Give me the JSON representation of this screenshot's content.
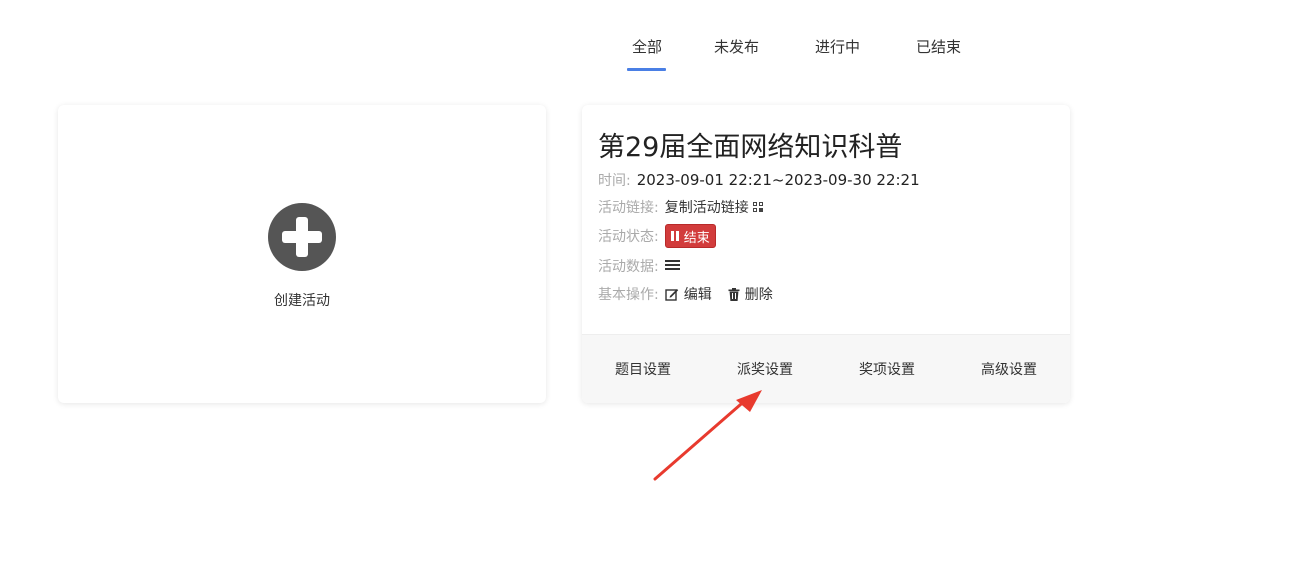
{
  "tabs": [
    {
      "label": "全部",
      "active": true
    },
    {
      "label": "未发布",
      "active": false
    },
    {
      "label": "进行中",
      "active": false
    },
    {
      "label": "已结束",
      "active": false
    }
  ],
  "create_card": {
    "label": "创建活动",
    "icon": "plus-circle-icon"
  },
  "activity": {
    "title": "第29届全面网络知识科普",
    "time_label": "时间:",
    "time_value": "2023-09-01 22:21~2023-09-30 22:21",
    "link_label": "活动链接:",
    "link_text": "复制活动链接",
    "status_label": "活动状态:",
    "status_value": "结束",
    "data_label": "活动数据:",
    "ops_label": "基本操作:",
    "edit_label": "编辑",
    "delete_label": "删除",
    "footer": {
      "question_settings": "题目设置",
      "award_settings": "派奖设置",
      "prize_settings": "奖项设置",
      "advanced_settings": "高级设置"
    }
  },
  "colors": {
    "tab_active_underline": "#4a7fe5",
    "status_badge": "#d23c3c",
    "annotation_arrow": "#e83a2e"
  }
}
